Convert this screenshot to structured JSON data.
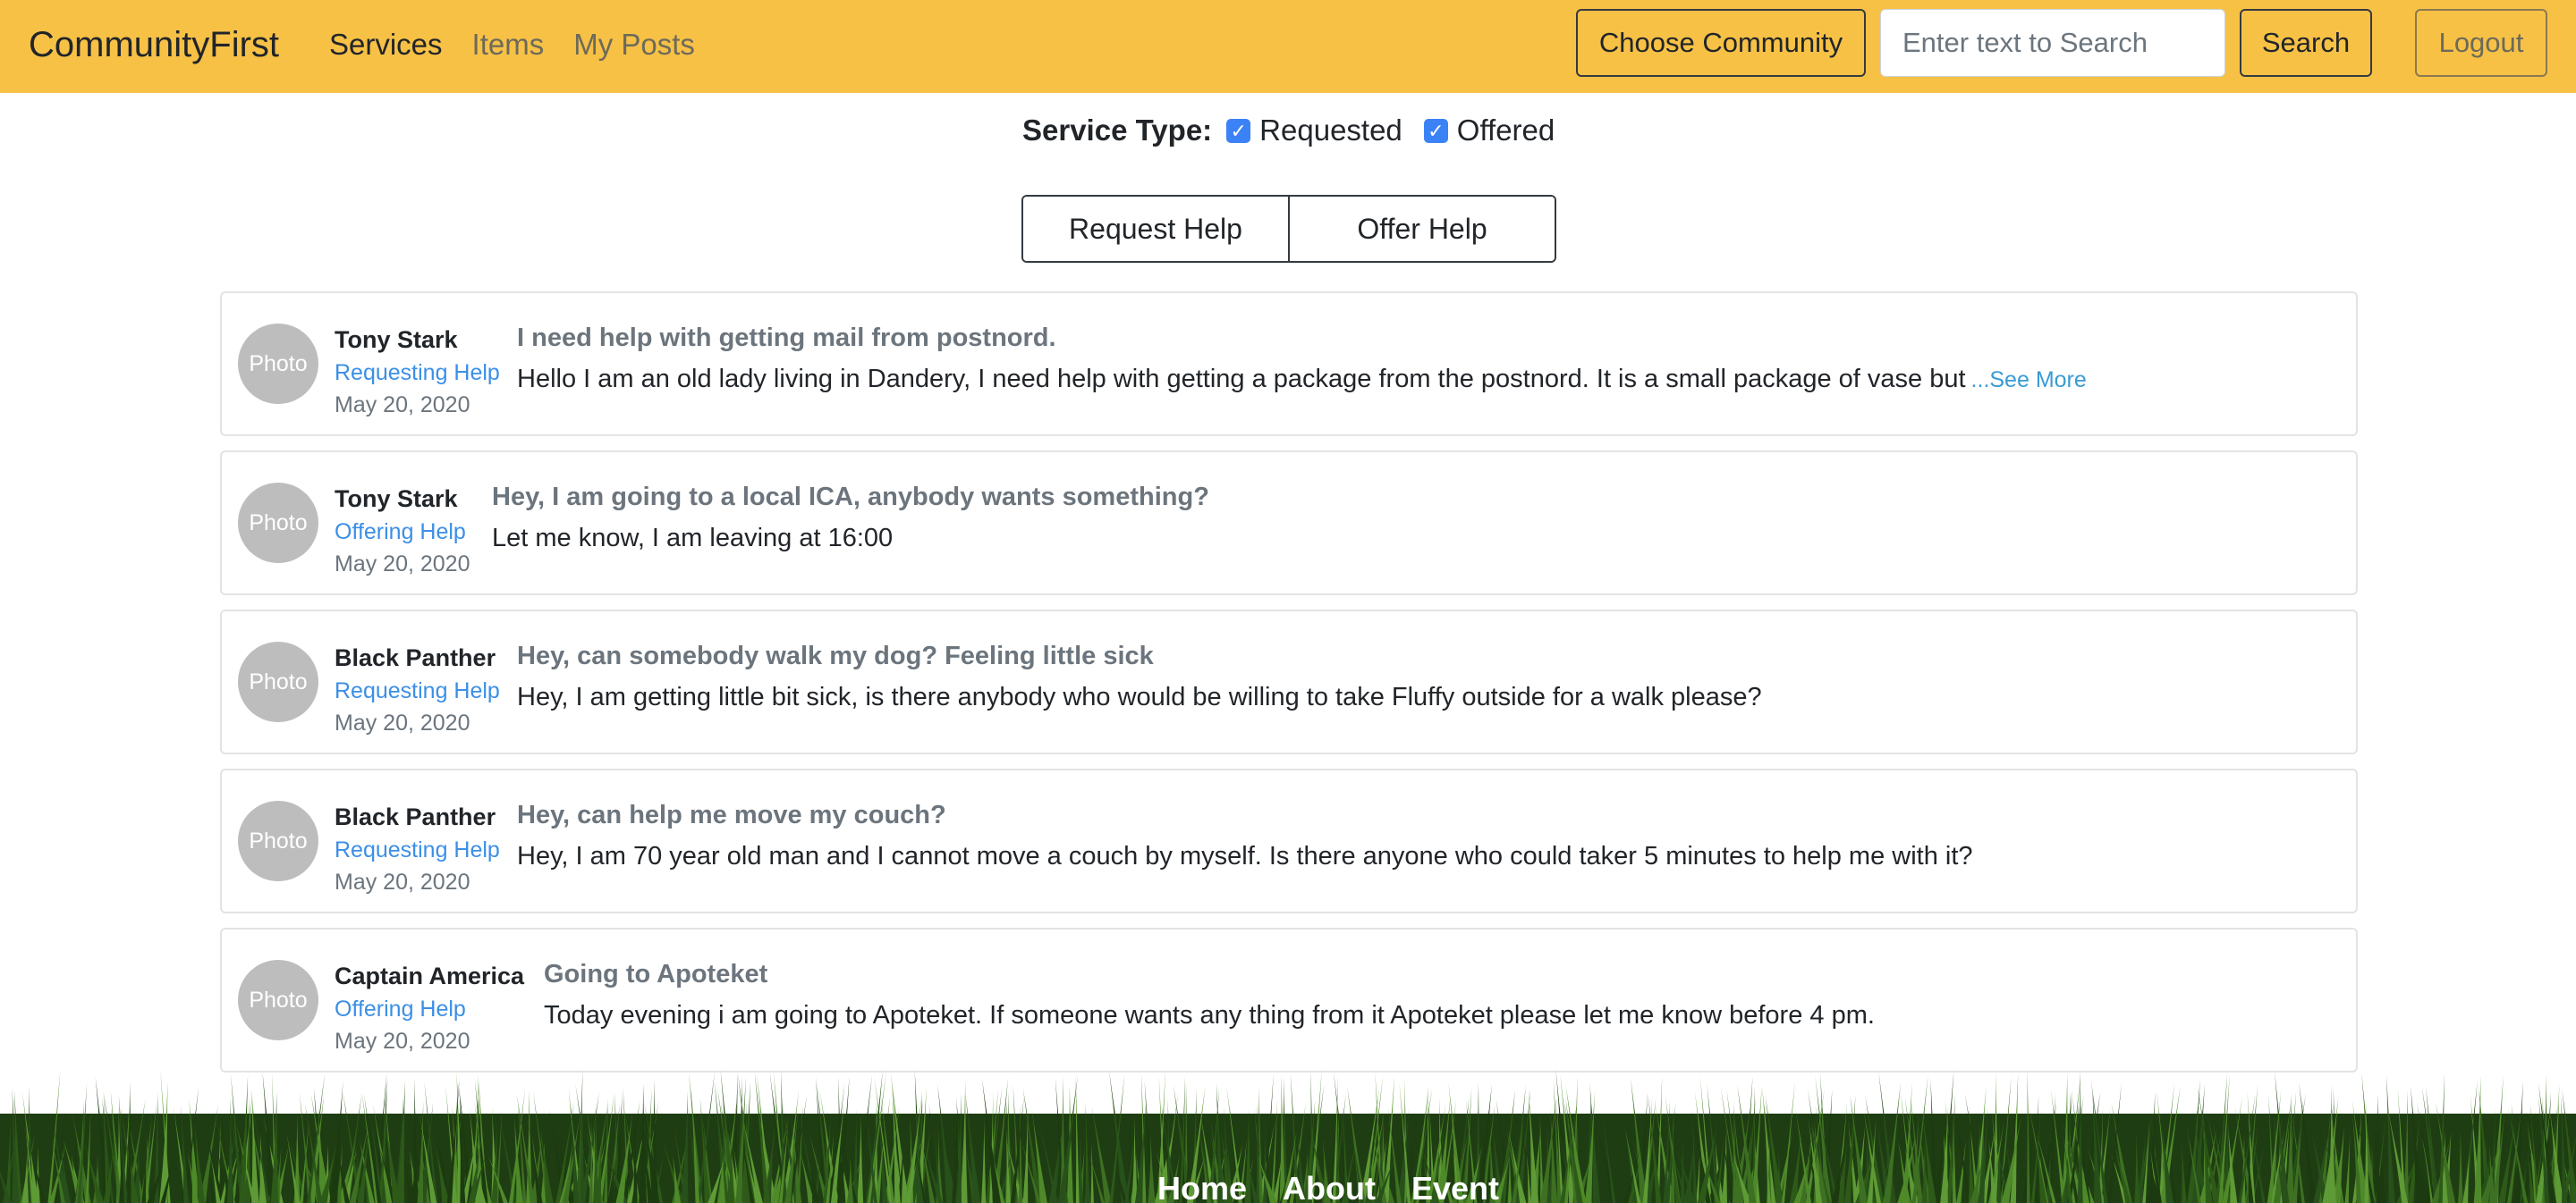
{
  "nav": {
    "brand": "CommunityFirst",
    "links": [
      "Services",
      "Items",
      "My Posts"
    ],
    "choose_community": "Choose Community",
    "search_placeholder": "Enter text to Search",
    "search_label": "Search",
    "logout_label": "Logout"
  },
  "filter": {
    "label": "Service Type:",
    "options": [
      {
        "label": "Requested",
        "checked": true
      },
      {
        "label": "Offered",
        "checked": true
      }
    ]
  },
  "actions": {
    "request_help": "Request Help",
    "offer_help": "Offer Help"
  },
  "posts": [
    {
      "avatar": "Photo",
      "name": "Tony Stark",
      "type": "Requesting Help",
      "date": "May 20, 2020",
      "title": "I need help with getting mail from postnord.",
      "body": "Hello I am an old lady living in Dandery, I need help with getting a package from the postnord. It is a small package of vase but",
      "more": "...See More"
    },
    {
      "avatar": "Photo",
      "name": "Tony Stark",
      "type": "Offering Help",
      "date": "May 20, 2020",
      "title": "Hey, I am going to a local ICA, anybody wants something?",
      "body": "Let me know, I am leaving at 16:00"
    },
    {
      "avatar": "Photo",
      "name": "Black Panther",
      "type": "Requesting Help",
      "date": "May 20, 2020",
      "title": "Hey, can somebody walk my dog? Feeling little sick",
      "body": "Hey, I am getting little bit sick, is there anybody who would be willing to take Fluffy outside for a walk please?"
    },
    {
      "avatar": "Photo",
      "name": "Black Panther",
      "type": "Requesting Help",
      "date": "May 20, 2020",
      "title": "Hey, can help me move my couch?",
      "body": "Hey, I am 70 year old man and I cannot move a couch by myself. Is there anyone who could taker 5 minutes to help me with it?"
    },
    {
      "avatar": "Photo",
      "name": "Captain America",
      "type": "Offering Help",
      "date": "May 20, 2020",
      "title": "Going to Apoteket",
      "body": "Today evening i am going to Apoteket. If someone wants any thing from it Apoteket please let me know before 4 pm."
    }
  ],
  "footer": {
    "links": [
      "Home",
      "About",
      "Event"
    ]
  },
  "colors": {
    "navbar": "#f7c146",
    "link_blue": "#3b8fe6",
    "checkbox": "#3b82f6",
    "grass_dark": "#1f3d12",
    "grass_light": "#4f8a2a"
  }
}
